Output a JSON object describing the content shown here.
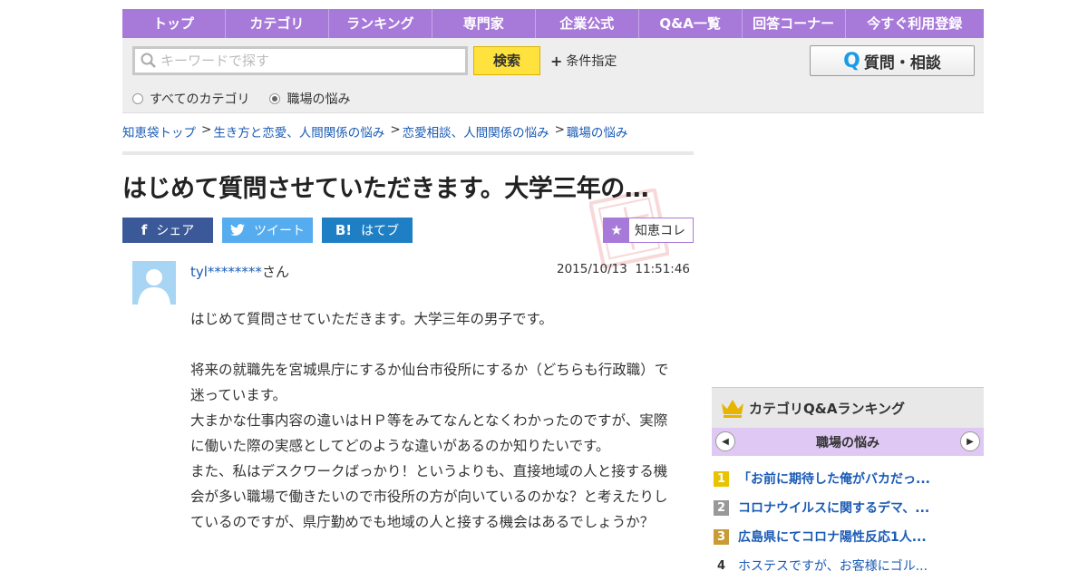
{
  "nav": {
    "items": [
      "トップ",
      "カテゴリ",
      "ランキング",
      "専門家",
      "企業公式",
      "Q&A一覧",
      "回答コーナー",
      "今すぐ利用登録"
    ]
  },
  "search": {
    "placeholder": "キーワードで探す",
    "button": "検索",
    "condition": "条件指定",
    "ask_button": "質問・相談",
    "ask_q": "Q",
    "radios": [
      {
        "label": "すべてのカテゴリ",
        "checked": false
      },
      {
        "label": "職場の悩み",
        "checked": true
      }
    ]
  },
  "breadcrumb": {
    "items": [
      "知恵袋トップ",
      "生き方と恋愛、人間関係の悩み",
      "恋愛相談、人間関係の悩み",
      "職場の悩み"
    ],
    "sep": ">"
  },
  "question": {
    "title": "はじめて質問させていただきます。大学三年の…",
    "share": {
      "facebook": "シェア",
      "twitter": "ツイート",
      "hatena": "はてブ",
      "chiecolle": "知恵コレ",
      "hatena_icon": "B!"
    },
    "user": "tyl********",
    "user_suffix": "さん",
    "date": "2015/10/13  11:51:46",
    "body": [
      "はじめて質問させていただきます。大学三年の男子です。",
      "",
      "将来の就職先を宮城県庁にするか仙台市役所にするか（どちらも行政職）で迷っています。",
      "大まかな仕事内容の違いはＨＰ等をみてなんとなくわかったのですが、実際に働いた際の実感としてどのような違いがあるのか知りたいです。",
      "また、私はデスクワークばっかり！というよりも、直接地域の人と接する機会が多い職場で働きたいので市役所の方が向いているのかな？と考えたりしているのですが、県庁勤めでも地域の人と接する機会はあるでしょうか？"
    ]
  },
  "ranking": {
    "title": "カテゴリQ&Aランキング",
    "category": "職場の悩み",
    "items": [
      {
        "rank": "1",
        "text": "「お前に期待した俺がバカだっ..."
      },
      {
        "rank": "2",
        "text": "コロナウイルスに関するデマ、..."
      },
      {
        "rank": "3",
        "text": "広島県にてコロナ陽性反応1人..."
      },
      {
        "rank": "4",
        "text": "ホステスですが、お客様にゴル..."
      }
    ]
  },
  "colors": {
    "nav_bg": "#a779d9",
    "link": "#1a5bb5",
    "search_button": "#ffe23d",
    "facebook": "#3b5998",
    "twitter": "#55acee",
    "hatena": "#1f7fc4"
  }
}
